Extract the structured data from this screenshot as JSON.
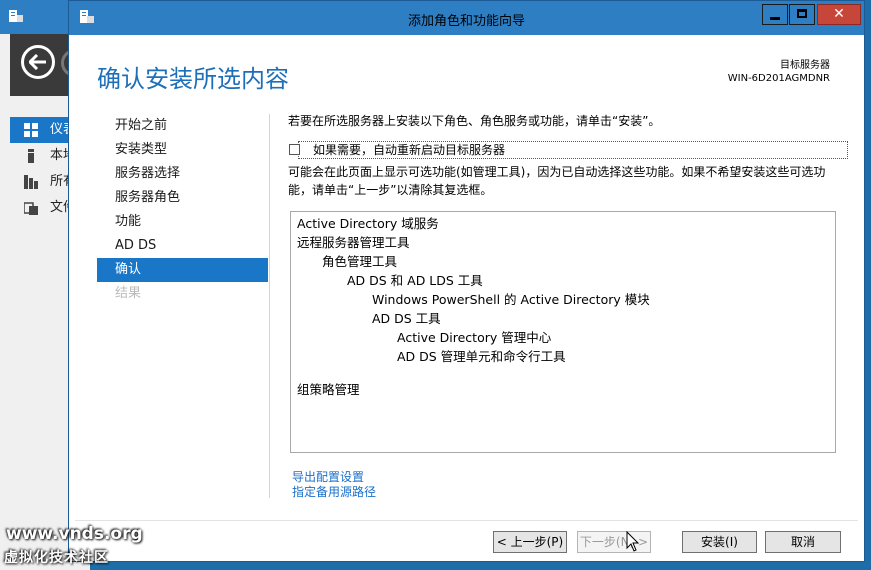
{
  "background_window": {
    "nav_items": [
      {
        "label": "仪表",
        "icon": "dashboard-icon",
        "selected": true
      },
      {
        "label": "本地",
        "icon": "local-server-icon",
        "selected": false
      },
      {
        "label": "所有",
        "icon": "all-servers-icon",
        "selected": false
      },
      {
        "label": "文件",
        "icon": "file-services-icon",
        "selected": false
      }
    ]
  },
  "dialog": {
    "title": "添加角色和功能向导",
    "heading": "确认安装所选内容",
    "server_caption": "目标服务器",
    "server_name": "WIN-6D201AGMDNR",
    "steps": [
      "开始之前",
      "安装类型",
      "服务器选择",
      "服务器角色",
      "功能",
      "AD DS",
      "确认",
      "结果"
    ],
    "active_step": "确认",
    "disabled_step": "结果",
    "intro_text": "若要在所选服务器上安装以下角色、角色服务或功能，请单击“安装”。",
    "restart_checkbox": {
      "label": "如果需要，自动重新启动目标服务器",
      "checked": false
    },
    "note_text": "可能会在此页面上显示可选功能(如管理工具)，因为已自动选择这些功能。如果不希望安装这些可选功能，请单击“上一步”以清除其复选框。",
    "features": [
      {
        "label": "Active Directory 域服务",
        "indent": 0
      },
      {
        "label": "远程服务器管理工具",
        "indent": 0
      },
      {
        "label": "角色管理工具",
        "indent": 1
      },
      {
        "label": "AD DS 和 AD LDS 工具",
        "indent": 2
      },
      {
        "label": "Windows PowerShell 的 Active Directory 模块",
        "indent": 3
      },
      {
        "label": "AD DS 工具",
        "indent": 3
      },
      {
        "label": "Active Directory 管理中心",
        "indent": 4
      },
      {
        "label": "AD DS 管理单元和命令行工具",
        "indent": 4
      },
      {
        "label": "组策略管理",
        "indent": 0
      }
    ],
    "links": {
      "export": "导出配置设置",
      "alternate_source": "指定备用源路径"
    },
    "buttons": {
      "prev": "< 上一步(P)",
      "next": "下一步(N) >",
      "install": "安装(I)",
      "cancel": "取消"
    }
  },
  "watermark": {
    "line1": "www.vnds.org",
    "line2": "虚拟化技术社区"
  }
}
